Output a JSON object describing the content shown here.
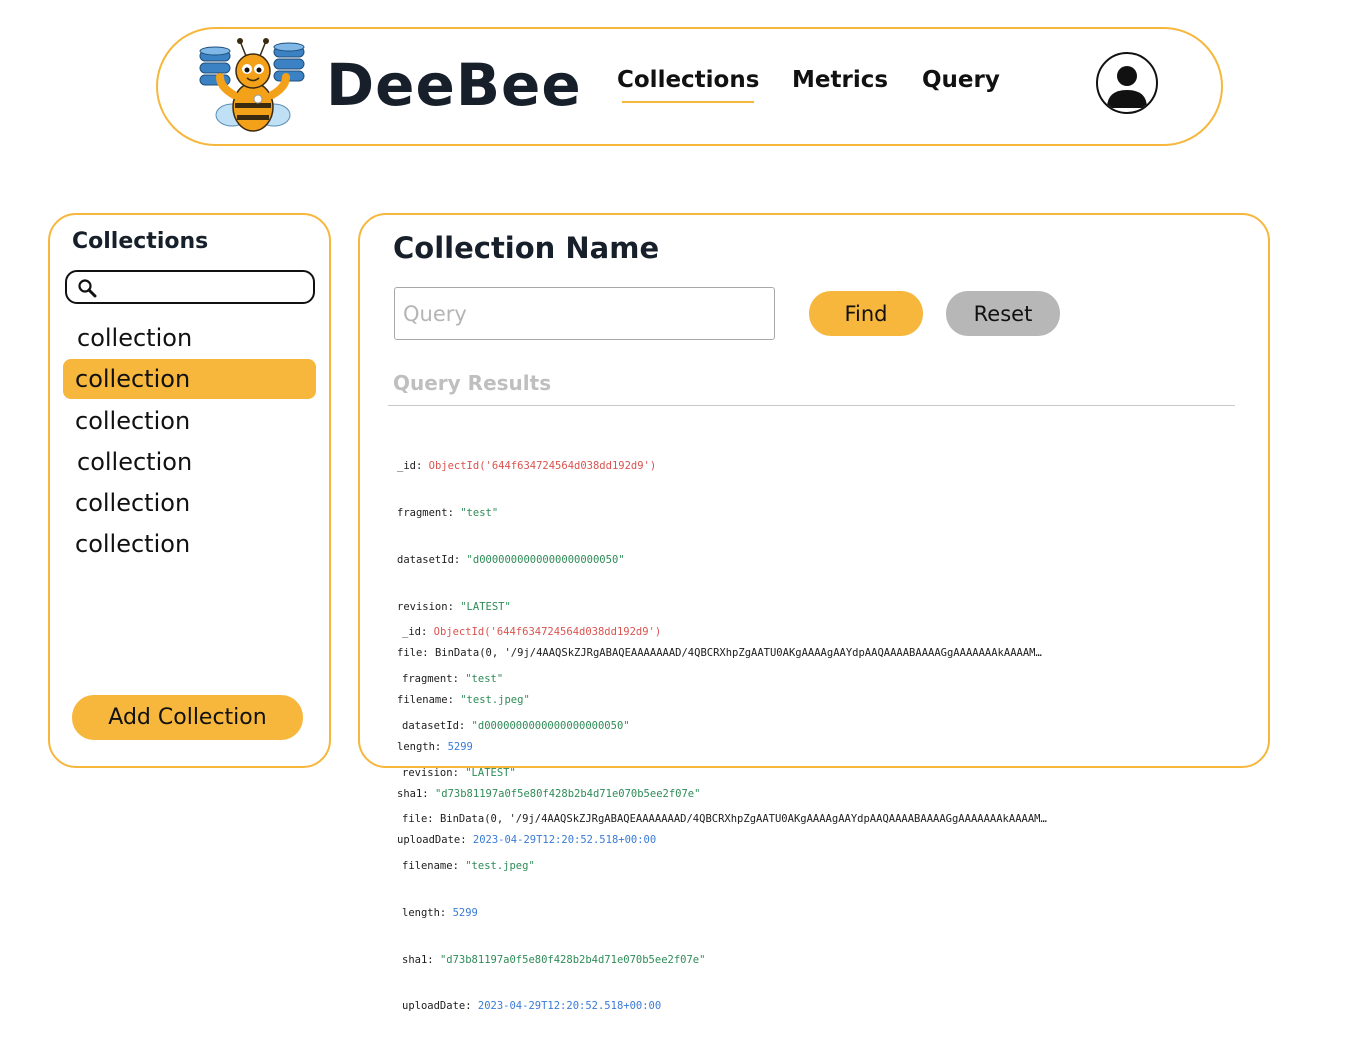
{
  "header": {
    "brand": "DeeBee",
    "nav": [
      {
        "label": "Collections"
      },
      {
        "label": "Metrics"
      },
      {
        "label": "Query"
      }
    ]
  },
  "sidebar": {
    "title": "Collections",
    "search_placeholder": "",
    "items": [
      {
        "label": "collection",
        "active": false
      },
      {
        "label": "collection",
        "active": true
      },
      {
        "label": "collection",
        "active": false
      },
      {
        "label": "collection",
        "active": false
      },
      {
        "label": "collection",
        "active": false
      },
      {
        "label": "collection",
        "active": false
      }
    ],
    "add_label": "Add Collection"
  },
  "main": {
    "title": "Collection Name",
    "query_placeholder": "Query",
    "find_label": "Find",
    "reset_label": "Reset",
    "results_label": "Query Results",
    "results": [
      {
        "id_key": "_id:",
        "id_val": "ObjectId('644f634724564d038dd192d9')",
        "fragment_key": "fragment:",
        "fragment_val": "\"test\"",
        "datasetId_key": "datasetId:",
        "datasetId_val": "\"d0000000000000000000050\"",
        "revision_key": "revision:",
        "revision_val": "\"LATEST\"",
        "file_key": "file:",
        "file_val": "BinData(0, '/9j/4AAQSkZJRgABAQEAAAAAAAD/4QBCRXhpZgAATU0AKgAAAAgAAYdpAAQAAAABAAAAGgAAAAAAAkAAAAM…",
        "filename_key": "filename:",
        "filename_val": "\"test.jpeg\"",
        "length_key": "length:",
        "length_val": "5299",
        "sha1_key": "sha1:",
        "sha1_val": "\"d73b81197a0f5e80f428b2b4d71e070b5ee2f07e\"",
        "uploadDate_key": "uploadDate:",
        "uploadDate_val": "2023-04-29T12:20:52.518+00:00"
      },
      {
        "id_key": "_id:",
        "id_val": "ObjectId('644f634724564d038dd192d9')",
        "fragment_key": "fragment:",
        "fragment_val": "\"test\"",
        "datasetId_key": "datasetId:",
        "datasetId_val": "\"d0000000000000000000050\"",
        "revision_key": "revision:",
        "revision_val": "\"LATEST\"",
        "file_key": "file:",
        "file_val": "BinData(0, '/9j/4AAQSkZJRgABAQEAAAAAAAD/4QBCRXhpZgAATU0AKgAAAAgAAYdpAAQAAAABAAAAGgAAAAAAAkAAAAM…",
        "filename_key": "filename:",
        "filename_val": "\"test.jpeg\"",
        "length_key": "length:",
        "length_val": "5299",
        "sha1_key": "sha1:",
        "sha1_val": "\"d73b81197a0f5e80f428b2b4d71e070b5ee2f07e\"",
        "uploadDate_key": "uploadDate:",
        "uploadDate_val": "2023-04-29T12:20:52.518+00:00"
      }
    ]
  },
  "colors": {
    "accent": "#f6b73c",
    "reset_button": "#b7b7b7",
    "object_id": "#d9534f",
    "string_value": "#2e8b57",
    "number_value": "#3a7bd5"
  },
  "icons": {
    "logo": "bee-mascot-logo",
    "search": "search-icon",
    "avatar": "user-avatar-icon"
  }
}
